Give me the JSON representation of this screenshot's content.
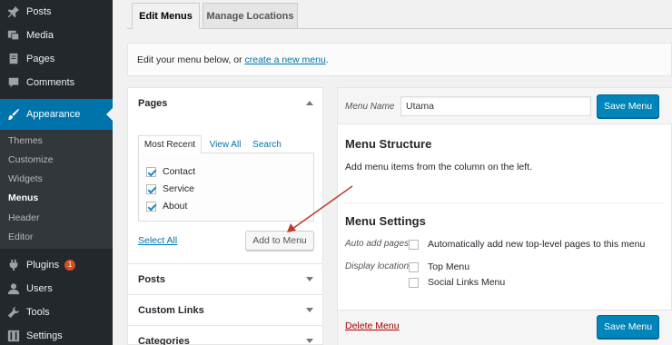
{
  "sidebar": {
    "items": [
      {
        "label": "Posts",
        "icon": "pin-icon"
      },
      {
        "label": "Media",
        "icon": "media-icon"
      },
      {
        "label": "Pages",
        "icon": "pages-icon"
      },
      {
        "label": "Comments",
        "icon": "comment-icon"
      },
      {
        "label": "Appearance",
        "icon": "brush-icon"
      },
      {
        "label": "Plugins",
        "icon": "plugin-icon",
        "badge": "1"
      },
      {
        "label": "Users",
        "icon": "user-icon"
      },
      {
        "label": "Tools",
        "icon": "wrench-icon"
      },
      {
        "label": "Settings",
        "icon": "settings-icon"
      }
    ],
    "submenu": [
      "Themes",
      "Customize",
      "Widgets",
      "Menus",
      "Header",
      "Editor"
    ]
  },
  "tabs": {
    "edit": "Edit Menus",
    "manage": "Manage Locations"
  },
  "manage_bar": {
    "text": "Edit your menu below, or",
    "link": "create a new menu",
    "suffix": "."
  },
  "left_panel": {
    "pages_title": "Pages",
    "inner_tabs": {
      "most_recent": "Most Recent",
      "view_all": "View All",
      "search": "Search"
    },
    "pages": [
      "Contact",
      "Service",
      "About"
    ],
    "select_all": "Select All",
    "add_button": "Add to Menu",
    "sections": [
      "Posts",
      "Custom Links",
      "Categories"
    ]
  },
  "editor": {
    "menu_name_label": "Menu Name",
    "menu_name_value": "Utama",
    "save_button": "Save Menu",
    "structure_title": "Menu Structure",
    "structure_hint": "Add menu items from the column on the left.",
    "settings_title": "Menu Settings",
    "auto_add_label": "Auto add pages",
    "auto_add_text": "Automatically add new top-level pages to this menu",
    "display_location_label": "Display location",
    "locations": [
      "Top Menu",
      "Social Links Menu"
    ],
    "delete_link": "Delete Menu"
  },
  "colors": {
    "sidebar_bg": "#23282d",
    "accent": "#0073aa",
    "primary_button": "#0085ba",
    "delete": "#aa0000",
    "annotation_arrow": "#c0392b"
  }
}
